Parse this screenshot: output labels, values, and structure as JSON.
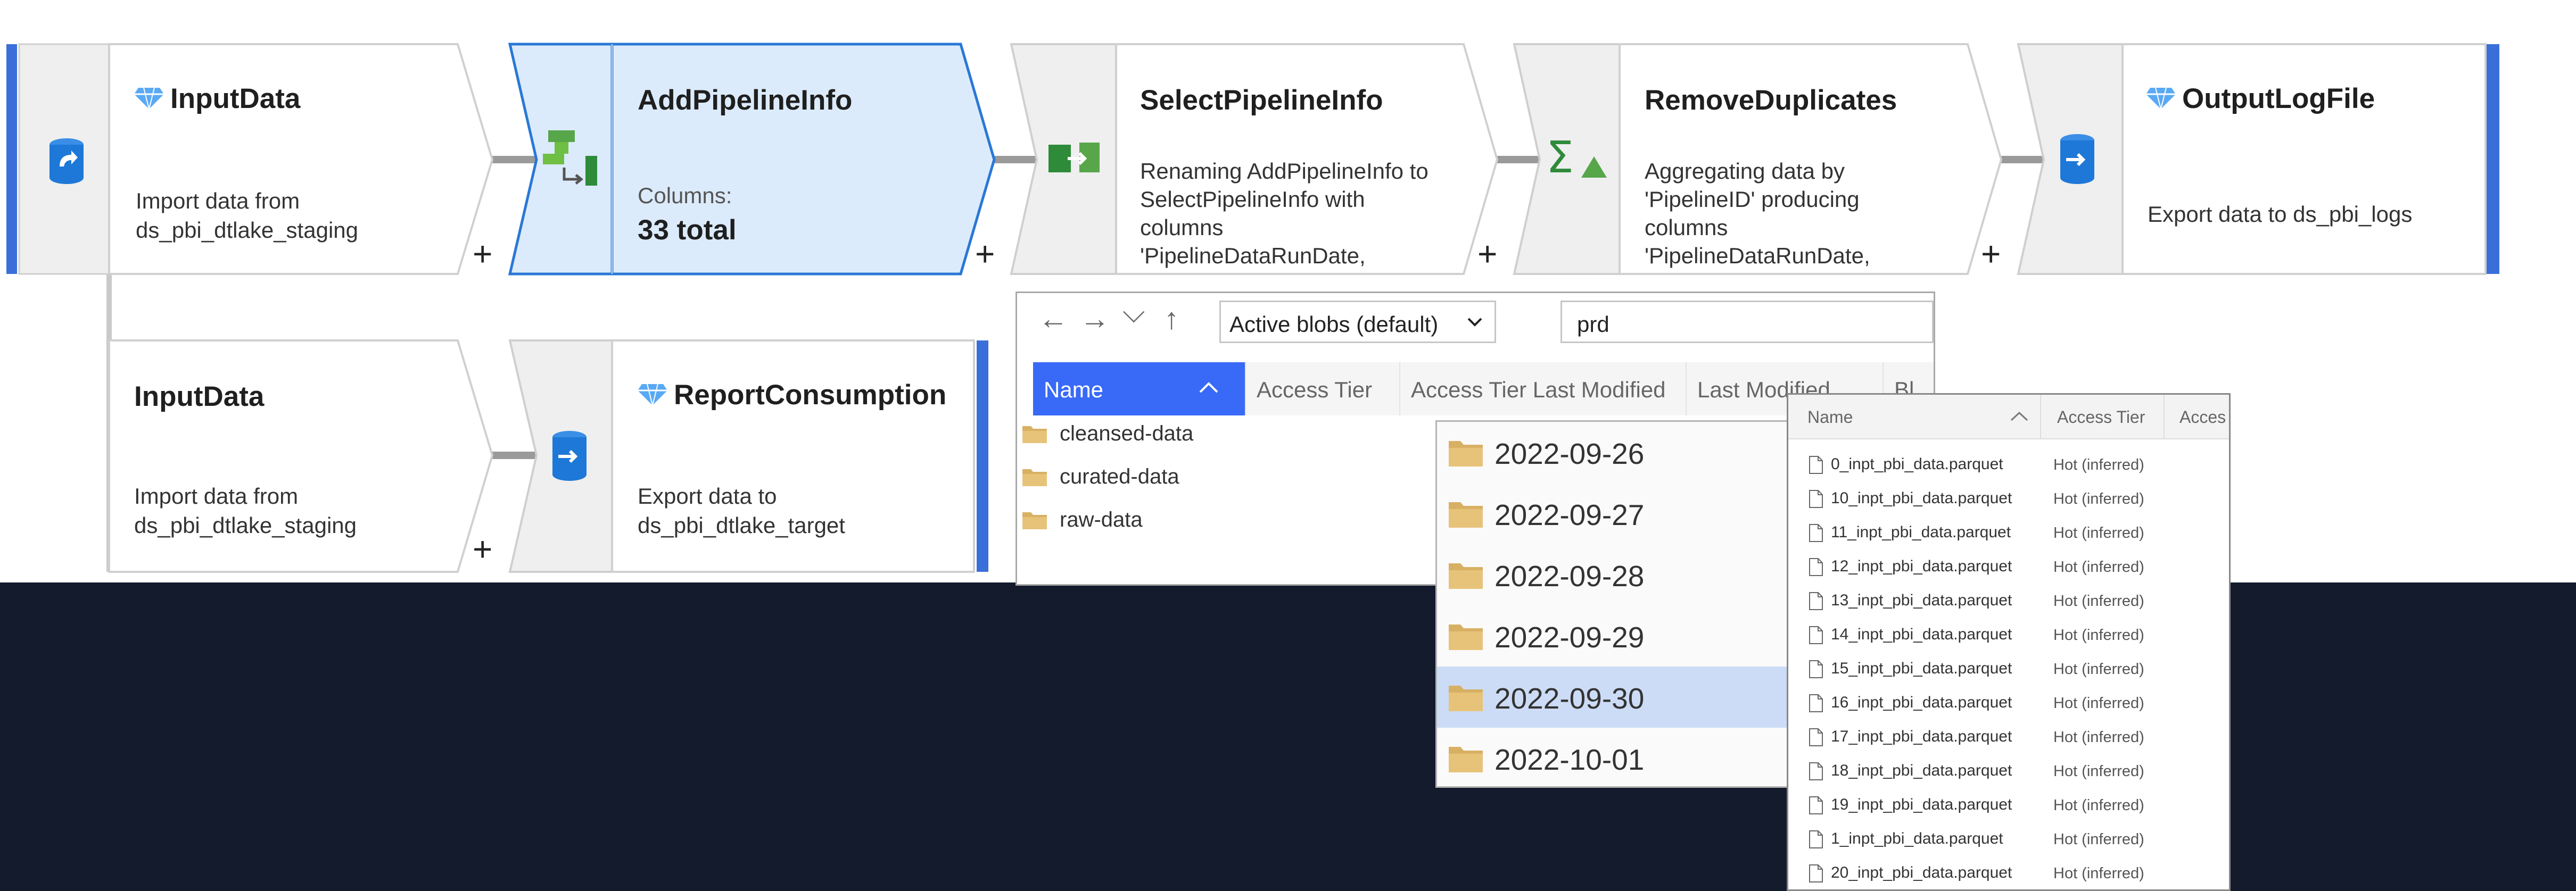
{
  "colors": {
    "selected_fill": "#dcebfb",
    "selected_stroke": "#2a78d6",
    "accent_bar": "#3a6fd9",
    "header_active": "#3869f7",
    "background_dark": "#131b2d"
  },
  "pipeline": {
    "row1": [
      {
        "title": "InputData",
        "desc": [
          "Import data from",
          "ds_pbi_dtlake_staging"
        ],
        "icon": "source-icon",
        "gem": true
      },
      {
        "title": "AddPipelineInfo",
        "desc_label": "Columns:",
        "desc_value": "33 total",
        "icon": "derived-column-icon",
        "selected": true
      },
      {
        "title": "SelectPipelineInfo",
        "desc": [
          "Renaming AddPipelineInfo to",
          "SelectPipelineInfo with",
          "columns",
          "'PipelineDataRunDate,"
        ],
        "icon": "select-icon"
      },
      {
        "title": "RemoveDuplicates",
        "desc": [
          "Aggregating data by",
          "'PipelineID' producing",
          "columns",
          "'PipelineDataRunDate,"
        ],
        "icon": "aggregate-icon"
      },
      {
        "title": "OutputLogFile",
        "desc": [
          "Export data to ds_pbi_logs"
        ],
        "icon": "sink-icon",
        "gem": true
      }
    ],
    "row2": [
      {
        "title": "InputData",
        "desc": [
          "Import data from",
          "ds_pbi_dtlake_staging"
        ]
      },
      {
        "title": "ReportConsumption",
        "desc": [
          "Export data to",
          "ds_pbi_dtlake_target"
        ],
        "icon": "sink-icon",
        "gem": true
      }
    ],
    "plus": "+"
  },
  "explorer": {
    "nav": {
      "back": "←",
      "forward": "→",
      "down": "⌵",
      "up": "↑"
    },
    "dropdown_value": "Active blobs (default)",
    "search_value": "prd",
    "columns": [
      "Name",
      "Access Tier",
      "Access Tier Last Modified",
      "Last Modified",
      "Bl"
    ],
    "folders": [
      "cleansed-data",
      "curated-data",
      "raw-data"
    ]
  },
  "dates": {
    "items": [
      "2022-09-26",
      "2022-09-27",
      "2022-09-28",
      "2022-09-29",
      "2022-09-30",
      "2022-10-01"
    ],
    "selected": "2022-09-30"
  },
  "files": {
    "columns": [
      "Name",
      "Access Tier",
      "Acces"
    ],
    "items": [
      {
        "name": "0_inpt_pbi_data.parquet",
        "tier": "Hot (inferred)"
      },
      {
        "name": "10_inpt_pbi_data.parquet",
        "tier": "Hot (inferred)"
      },
      {
        "name": "11_inpt_pbi_data.parquet",
        "tier": "Hot (inferred)"
      },
      {
        "name": "12_inpt_pbi_data.parquet",
        "tier": "Hot (inferred)"
      },
      {
        "name": "13_inpt_pbi_data.parquet",
        "tier": "Hot (inferred)"
      },
      {
        "name": "14_inpt_pbi_data.parquet",
        "tier": "Hot (inferred)"
      },
      {
        "name": "15_inpt_pbi_data.parquet",
        "tier": "Hot (inferred)"
      },
      {
        "name": "16_inpt_pbi_data.parquet",
        "tier": "Hot (inferred)"
      },
      {
        "name": "17_inpt_pbi_data.parquet",
        "tier": "Hot (inferred)"
      },
      {
        "name": "18_inpt_pbi_data.parquet",
        "tier": "Hot (inferred)"
      },
      {
        "name": "19_inpt_pbi_data.parquet",
        "tier": "Hot (inferred)"
      },
      {
        "name": "1_inpt_pbi_data.parquet",
        "tier": "Hot (inferred)"
      },
      {
        "name": "20_inpt_pbi_data.parquet",
        "tier": "Hot (inferred)"
      }
    ]
  }
}
